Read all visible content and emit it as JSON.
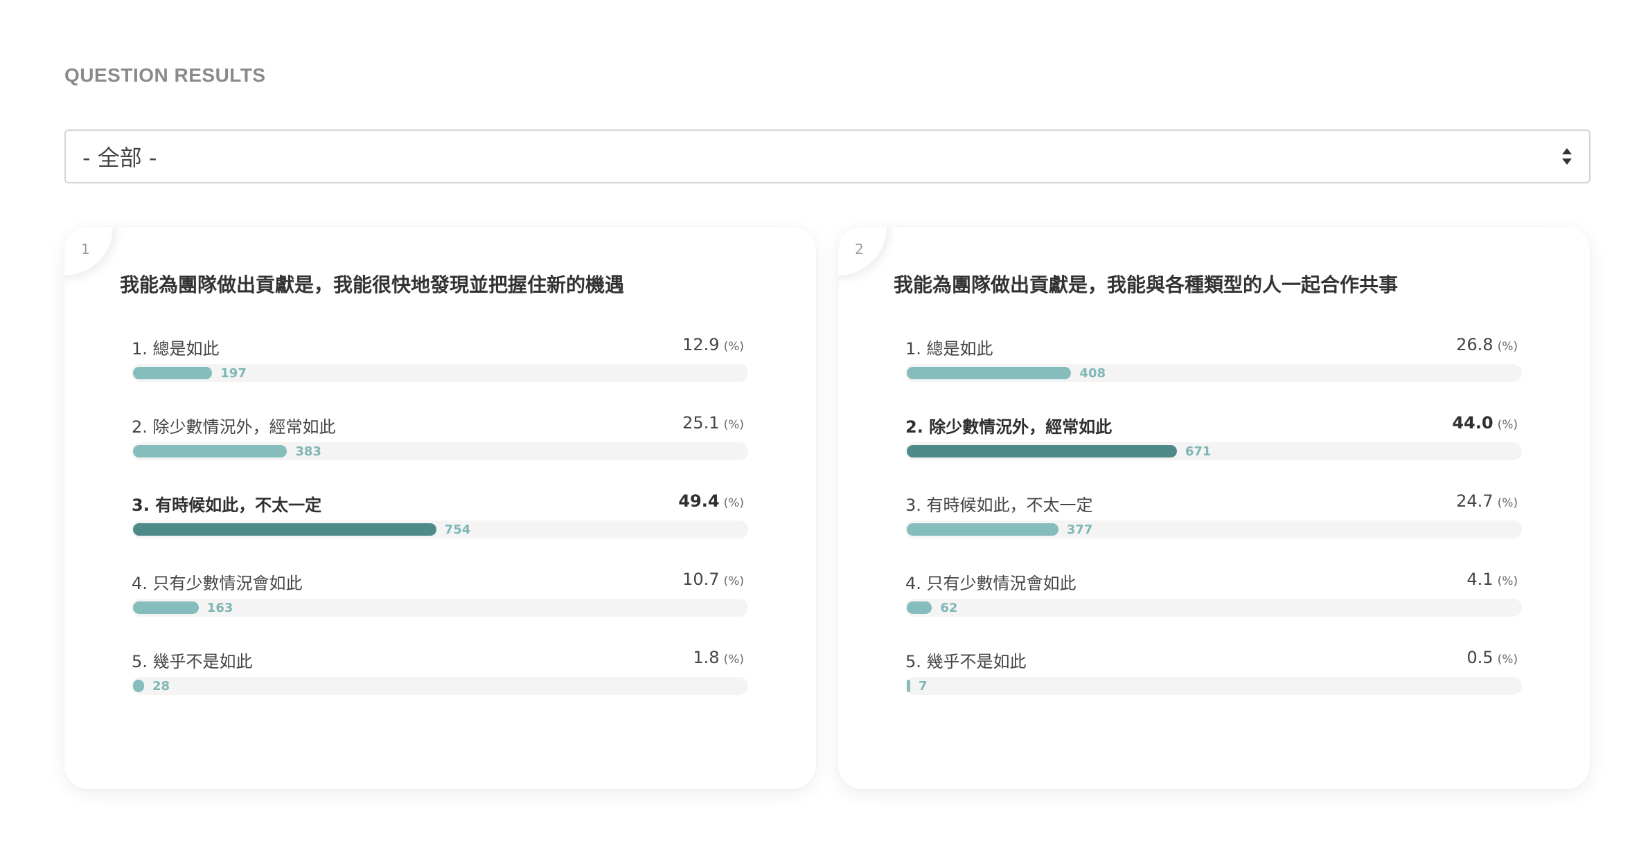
{
  "section_title": "QUESTION RESULTS",
  "filter": {
    "selected": "- 全部 -"
  },
  "questions": [
    {
      "number": "1",
      "title": "我能為團隊做出貢獻是，我能很快地發現並把握住新的機遇",
      "unit": "(%)",
      "options": [
        {
          "label": "1. 總是如此",
          "percent": "12.9",
          "count": "197",
          "highlight": false
        },
        {
          "label": "2. 除少數情況外，經常如此",
          "percent": "25.1",
          "count": "383",
          "highlight": false
        },
        {
          "label": "3. 有時候如此，不太一定",
          "percent": "49.4",
          "count": "754",
          "highlight": true
        },
        {
          "label": "4. 只有少數情況會如此",
          "percent": "10.7",
          "count": "163",
          "highlight": false
        },
        {
          "label": "5. 幾乎不是如此",
          "percent": "1.8",
          "count": "28",
          "highlight": false
        }
      ]
    },
    {
      "number": "2",
      "title": "我能為團隊做出貢獻是，我能與各種類型的人一起合作共事",
      "unit": "(%)",
      "options": [
        {
          "label": "1. 總是如此",
          "percent": "26.8",
          "count": "408",
          "highlight": false
        },
        {
          "label": "2. 除少數情況外，經常如此",
          "percent": "44.0",
          "count": "671",
          "highlight": true
        },
        {
          "label": "3. 有時候如此，不太一定",
          "percent": "24.7",
          "count": "377",
          "highlight": false
        },
        {
          "label": "4. 只有少數情況會如此",
          "percent": "4.1",
          "count": "62",
          "highlight": false
        },
        {
          "label": "5. 幾乎不是如此",
          "percent": "0.5",
          "count": "7",
          "highlight": false
        }
      ]
    }
  ],
  "colors": {
    "bar_default": "#85bcbc",
    "bar_highlight": "#4f8a8a",
    "count_text": "#7fb6b6",
    "track": "#f4f4f4"
  }
}
